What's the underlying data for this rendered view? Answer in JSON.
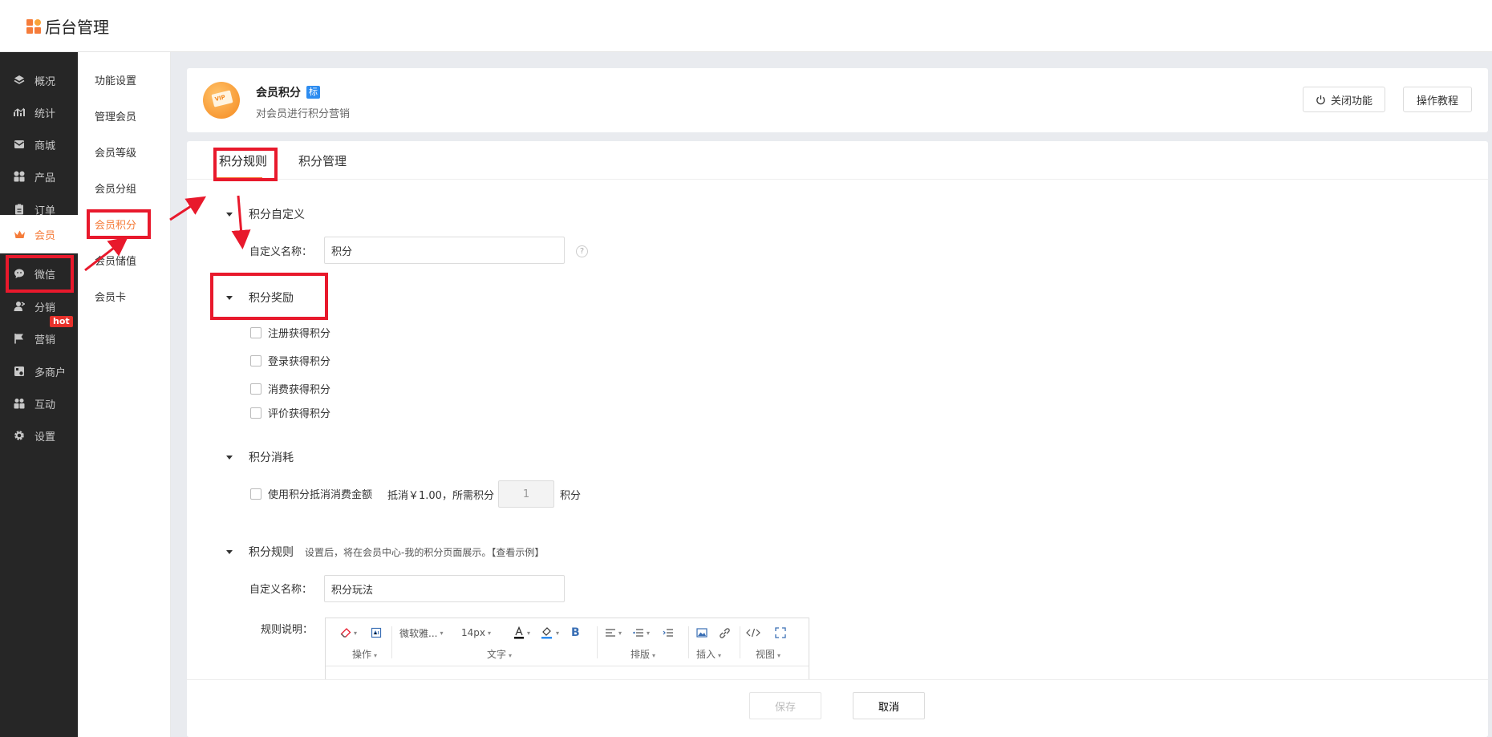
{
  "app": {
    "title": "后台管理"
  },
  "sidebar": {
    "items": [
      {
        "label": "概况",
        "icon": "layers-icon"
      },
      {
        "label": "统计",
        "icon": "chart-icon"
      },
      {
        "label": "商城",
        "icon": "mail-icon"
      },
      {
        "label": "产品",
        "icon": "grid-icon"
      },
      {
        "label": "订单",
        "icon": "clipboard-icon"
      },
      {
        "label": "会员",
        "icon": "crown-icon",
        "active": true
      },
      {
        "label": "微信",
        "icon": "wechat-icon"
      },
      {
        "label": "分销",
        "icon": "user-share-icon"
      },
      {
        "label": "营销",
        "icon": "flag-icon",
        "badge": "hot"
      },
      {
        "label": "多商户",
        "icon": "store-icon"
      },
      {
        "label": "互动",
        "icon": "users-icon"
      },
      {
        "label": "设置",
        "icon": "gear-icon"
      }
    ]
  },
  "submenu": {
    "items": [
      "功能设置",
      "管理会员",
      "会员等级",
      "会员分组",
      "会员积分",
      "会员储值",
      "会员卡"
    ],
    "active_index": 4
  },
  "header": {
    "title": "会员积分",
    "badge": "标",
    "icon_text": "VIP",
    "description": "对会员进行积分营销",
    "close_label": "关闭功能",
    "tutorial_label": "操作教程"
  },
  "tabs": [
    "积分规则",
    "积分管理"
  ],
  "sections": {
    "custom": {
      "title": "积分自定义",
      "name_label": "自定义名称：",
      "name_value": "积分",
      "help": "?"
    },
    "reward": {
      "title": "积分奖励",
      "options": [
        "注册获得积分",
        "登录获得积分",
        "消费获得积分",
        "评价获得积分"
      ]
    },
    "consume": {
      "title": "积分消耗",
      "option": "使用积分抵消消费金额",
      "offset_text": "抵消￥1.00，所需积分",
      "points_value": "1",
      "unit": "积分"
    },
    "rules": {
      "title": "积分规则",
      "note": "设置后，将在会员中心-我的积分页面展示。【查看示例】",
      "name_label": "自定义名称：",
      "name_value": "积分玩法",
      "desc_label": "规则说明："
    }
  },
  "editor": {
    "font_family": "微软雅...",
    "font_size": "14px",
    "groups": [
      "操作",
      "文字",
      "排版",
      "插入",
      "视图"
    ],
    "colors": {
      "font": "#000000",
      "highlight": "#2d8cf0"
    }
  },
  "footer": {
    "save_label": "保存",
    "cancel_label": "取消"
  },
  "colors": {
    "accent": "#f57c3a",
    "sidebar_bg": "#262626",
    "annotation": "#e8192c",
    "badge_blue": "#2d8cf0"
  }
}
